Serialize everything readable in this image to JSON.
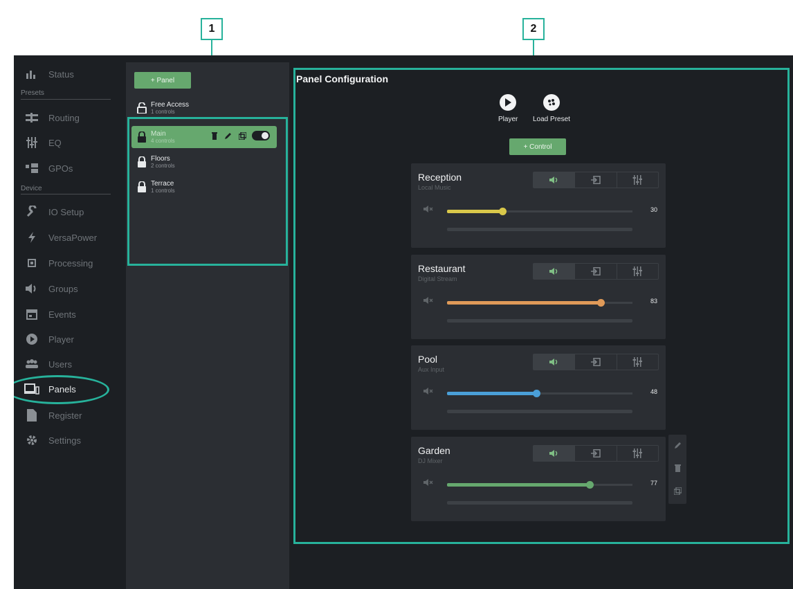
{
  "callouts": [
    "1",
    "2"
  ],
  "nav": {
    "items": [
      {
        "label": "Status",
        "icon": "bar-chart-icon"
      },
      {
        "label": "Routing",
        "icon": "routing-icon"
      },
      {
        "label": "EQ",
        "icon": "eq-sliders-icon"
      },
      {
        "label": "GPOs",
        "icon": "gpo-icon"
      },
      {
        "label": "IO Setup",
        "icon": "wrench-icon"
      },
      {
        "label": "VersaPower",
        "icon": "bolt-icon"
      },
      {
        "label": "Processing",
        "icon": "chip-icon"
      },
      {
        "label": "Groups",
        "icon": "speaker-icon"
      },
      {
        "label": "Events",
        "icon": "calendar-icon"
      },
      {
        "label": "Player",
        "icon": "play-icon"
      },
      {
        "label": "Users",
        "icon": "users-icon"
      },
      {
        "label": "Panels",
        "icon": "panels-icon"
      },
      {
        "label": "Register",
        "icon": "document-icon"
      },
      {
        "label": "Settings",
        "icon": "gear-icon"
      }
    ],
    "sections": {
      "presets": "Presets",
      "device": "Device"
    },
    "selected": "Panels"
  },
  "panels": {
    "add_label": "+ Panel",
    "list": [
      {
        "name": "Free Access",
        "sub": "1 controls",
        "locked": false
      },
      {
        "name": "Main",
        "sub": "4 controls",
        "locked": true,
        "active": true
      },
      {
        "name": "Floors",
        "sub": "2 controls",
        "locked": true
      },
      {
        "name": "Terrace",
        "sub": "1 controls",
        "locked": true
      }
    ],
    "row_actions": [
      "trash-icon",
      "pencil-icon",
      "copy-icon",
      "toggle-switch"
    ]
  },
  "config": {
    "title": "Panel Configuration",
    "buttons": [
      {
        "label": "Player",
        "icon": "play-circle-icon"
      },
      {
        "label": "Load Preset",
        "icon": "palette-icon"
      }
    ],
    "add_control_label": "+ Control",
    "controls": [
      {
        "name": "Reception",
        "source": "Local Music",
        "value": 30,
        "level": 0.3,
        "color": "#d9c84a"
      },
      {
        "name": "Restaurant",
        "source": "Digital Stream",
        "value": 83,
        "level": 0.83,
        "color": "#e09a58"
      },
      {
        "name": "Pool",
        "source": "Aux Input",
        "value": 48,
        "level": 0.48,
        "color": "#4a9fd8"
      },
      {
        "name": "Garden",
        "source": "DJ Mixer",
        "value": 77,
        "level": 0.77,
        "color": "#66a86e"
      }
    ],
    "segment_icons": [
      "volume-icon",
      "input-icon",
      "mixer-icon"
    ],
    "side_tools": [
      "pencil-icon",
      "trash-icon",
      "copy-icon"
    ]
  },
  "colors": {
    "accent": "#66a86e",
    "highlight": "#27b29b",
    "background": "#1c1f23"
  }
}
